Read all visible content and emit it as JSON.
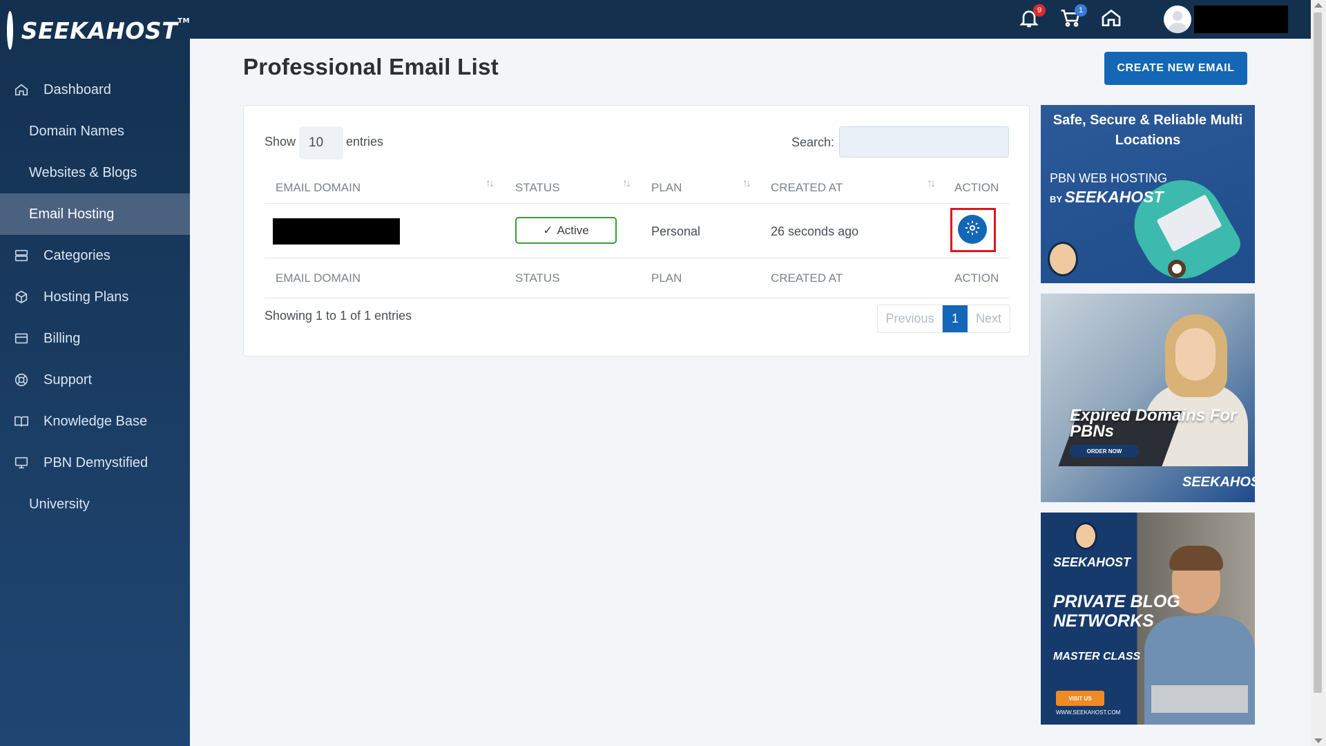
{
  "brand": {
    "name": "SEEKAHOST",
    "tm": "TM"
  },
  "sidebar": {
    "items": [
      {
        "label": "Dashboard",
        "icon": "home-icon"
      },
      {
        "label": "Domain Names"
      },
      {
        "label": "Websites & Blogs"
      },
      {
        "label": "Email Hosting",
        "active": true
      },
      {
        "label": "Categories",
        "icon": "server-icon"
      },
      {
        "label": "Hosting Plans",
        "icon": "box-icon"
      },
      {
        "label": "Billing",
        "icon": "credit-card-icon"
      },
      {
        "label": "Support",
        "icon": "lifebuoy-icon"
      },
      {
        "label": "Knowledge Base",
        "icon": "book-icon"
      },
      {
        "label": "PBN Demystified",
        "icon": "monitor-icon"
      },
      {
        "label": "University"
      }
    ]
  },
  "topbar": {
    "notifications_count": "9",
    "cart_count": "1"
  },
  "page": {
    "title": "Professional Email List",
    "create_button": "CREATE NEW EMAIL"
  },
  "table": {
    "show_label": "Show",
    "page_size": "10",
    "entries_label": "entries",
    "search_label": "Search:",
    "search_value": "",
    "columns": [
      "EMAIL DOMAIN",
      "STATUS",
      "PLAN",
      "CREATED AT",
      "ACTION"
    ],
    "rows": [
      {
        "email_domain": "",
        "status": "Active",
        "plan": "Personal",
        "created_at": "26 seconds ago"
      }
    ],
    "showing": "Showing 1 to 1 of 1 entries",
    "pagination": {
      "previous": "Previous",
      "current": "1",
      "next": "Next"
    }
  },
  "ads": {
    "ad1": {
      "headline": "Safe, Secure & Reliable Multi Locations",
      "line1": "PBN WEB HOSTING",
      "by": "BY",
      "brand": "SEEKAHOST"
    },
    "ad2": {
      "headline": "Expired Domains For PBNs",
      "cta": "ORDER NOW",
      "brand": "SEEKAHOST"
    },
    "ad3": {
      "brand": "SEEKAHOST",
      "headline": "PRIVATE BLOG NETWORKS",
      "sub": "MASTER CLASS",
      "cta": "VISIT US",
      "url": "WWW.SEEKAHOST.COM"
    }
  },
  "colors": {
    "primary": "#1466b6",
    "sidebar": "#13304f",
    "active_status": "#3a9a3a",
    "highlight": "#e0161f"
  }
}
